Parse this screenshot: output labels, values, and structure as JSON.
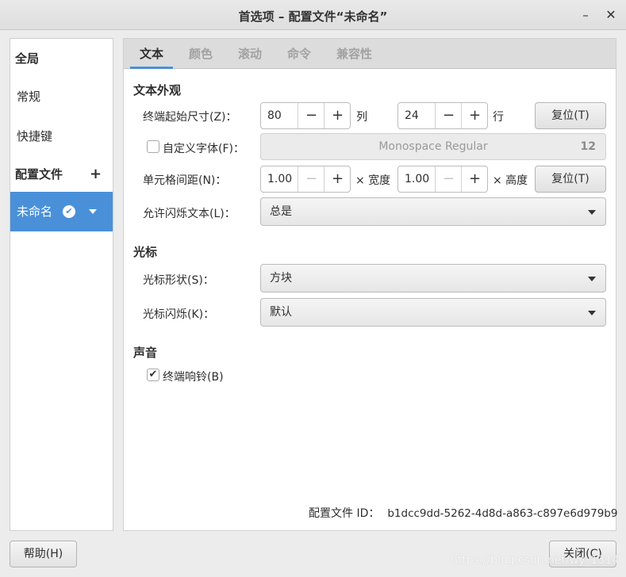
{
  "window": {
    "title": "首选项 – 配置文件“未命名”",
    "minimize_glyph": "–",
    "close_glyph": "✕"
  },
  "sidebar": {
    "items": [
      {
        "label": "全局",
        "kind": "header"
      },
      {
        "label": "常规",
        "kind": "item"
      },
      {
        "label": "快捷键",
        "kind": "item"
      },
      {
        "label": "配置文件",
        "kind": "header",
        "action": "+"
      },
      {
        "label": "未命名",
        "kind": "profile",
        "selected": true,
        "default_check": "✔"
      }
    ]
  },
  "tabs": [
    {
      "label": "文本",
      "active": true
    },
    {
      "label": "颜色",
      "active": false
    },
    {
      "label": "滚动",
      "active": false
    },
    {
      "label": "命令",
      "active": false
    },
    {
      "label": "兼容性",
      "active": false
    }
  ],
  "text_appearance": {
    "section": "文本外观",
    "size_label": "终端起始尺寸(Z)：",
    "columns_value": "80",
    "columns_unit": "列",
    "rows_value": "24",
    "rows_unit": "行",
    "reset_label": "复位(T)",
    "custom_font_label": "自定义字体(F)：",
    "custom_font_checked": false,
    "font_name": "Monospace Regular",
    "font_size": "12",
    "spacing_label": "单元格间距(N)：",
    "width_value": "1.00",
    "width_unit": "× 宽度",
    "height_value": "1.00",
    "height_unit": "× 高度",
    "reset2_label": "复位(T)",
    "blink_text_label": "允许闪烁文本(L)：",
    "blink_text_value": "总是"
  },
  "cursor": {
    "section": "光标",
    "shape_label": "光标形状(S)：",
    "shape_value": "方块",
    "blink_label": "光标闪烁(K)：",
    "blink_value": "默认"
  },
  "sound": {
    "section": "声音",
    "bell_label": "终端响铃(B)",
    "bell_checked": true
  },
  "profile_id": {
    "label": "配置文件 ID：",
    "value": "b1dcc9dd-5262-4d8d-a863-c897e6d979b9"
  },
  "footer": {
    "help_label": "帮助(H)",
    "close_label": "关闭(C)"
  },
  "watermark": "https://blog.csdn.net/wy_1314",
  "spinner_glyphs": {
    "minus": "−",
    "plus": "+"
  },
  "colors": {
    "accent": "#4a90d9"
  }
}
